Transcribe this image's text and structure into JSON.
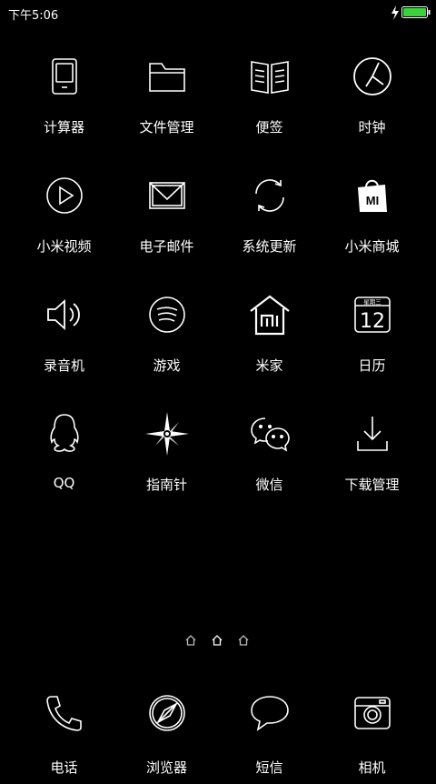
{
  "status": {
    "time": "下午5:06",
    "battery_color": "#3bd13b"
  },
  "grid": [
    {
      "label": "计算器",
      "icon": "calculator-icon"
    },
    {
      "label": "文件管理",
      "icon": "folder-icon"
    },
    {
      "label": "便签",
      "icon": "notes-icon"
    },
    {
      "label": "时钟",
      "icon": "clock-icon"
    },
    {
      "label": "小米视频",
      "icon": "video-play-icon"
    },
    {
      "label": "电子邮件",
      "icon": "mail-icon"
    },
    {
      "label": "系统更新",
      "icon": "update-icon"
    },
    {
      "label": "小米商城",
      "icon": "mi-store-bag-icon"
    },
    {
      "label": "录音机",
      "icon": "speaker-icon"
    },
    {
      "label": "游戏",
      "icon": "games-icon"
    },
    {
      "label": "米家",
      "icon": "mi-home-icon"
    },
    {
      "label": "日历",
      "icon": "calendar-icon"
    },
    {
      "label": "QQ",
      "icon": "qq-penguin-icon"
    },
    {
      "label": "指南针",
      "icon": "compass-star-icon"
    },
    {
      "label": "微信",
      "icon": "wechat-icon"
    },
    {
      "label": "下载管理",
      "icon": "download-icon"
    }
  ],
  "calendar": {
    "header": "星期三",
    "day": "12"
  },
  "mi_logo": "MI",
  "dock": [
    {
      "label": "电话",
      "icon": "phone-icon"
    },
    {
      "label": "浏览器",
      "icon": "browser-compass-icon"
    },
    {
      "label": "短信",
      "icon": "message-bubble-icon"
    },
    {
      "label": "相机",
      "icon": "camera-icon"
    }
  ],
  "pages": {
    "count": 3
  }
}
